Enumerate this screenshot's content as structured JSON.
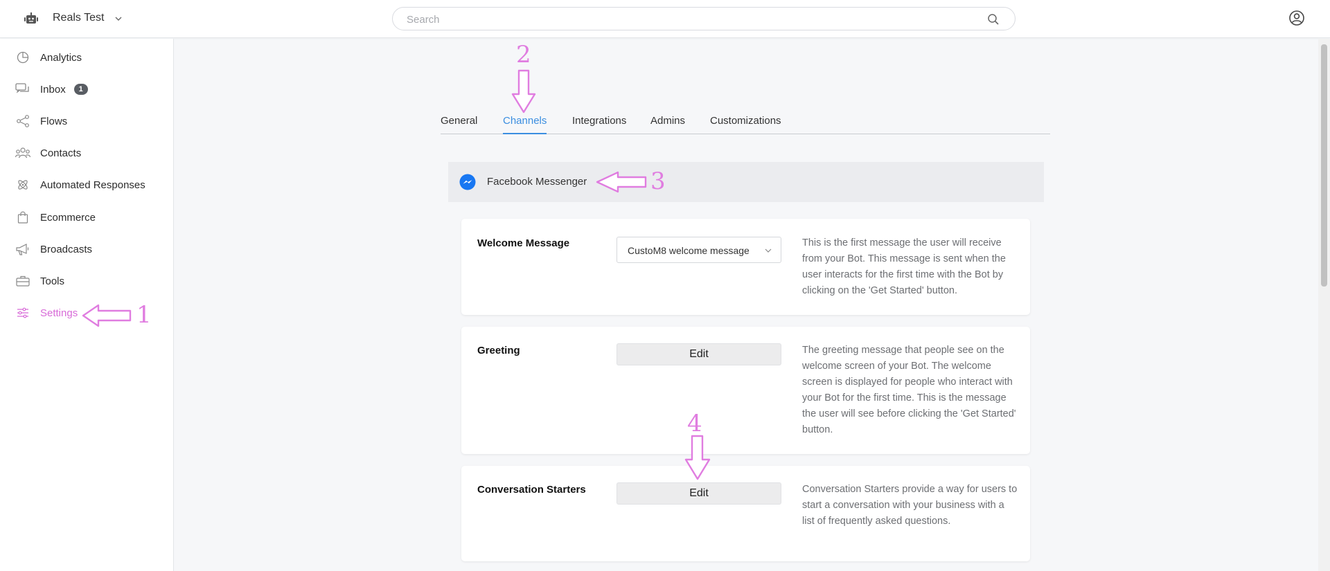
{
  "header": {
    "app_name": "Reals Test",
    "search_placeholder": "Search"
  },
  "sidebar": {
    "items": [
      {
        "label": "Analytics",
        "icon": "pie-chart-icon"
      },
      {
        "label": "Inbox",
        "icon": "chat-bubbles-icon",
        "badge": "1"
      },
      {
        "label": "Flows",
        "icon": "flow-nodes-icon"
      },
      {
        "label": "Contacts",
        "icon": "people-icon"
      },
      {
        "label": "Automated Responses",
        "icon": "atom-icon"
      },
      {
        "label": "Ecommerce",
        "icon": "shopping-bag-icon"
      },
      {
        "label": "Broadcasts",
        "icon": "megaphone-icon"
      },
      {
        "label": "Tools",
        "icon": "toolbox-icon"
      },
      {
        "label": "Settings",
        "icon": "sliders-icon",
        "active": true
      }
    ]
  },
  "tabs": [
    {
      "label": "General"
    },
    {
      "label": "Channels",
      "active": true
    },
    {
      "label": "Integrations"
    },
    {
      "label": "Admins"
    },
    {
      "label": "Customizations"
    }
  ],
  "channel": {
    "title": "Facebook Messenger"
  },
  "settings": {
    "welcome": {
      "title": "Welcome Message",
      "selected": "CustoM8 welcome message",
      "description": "This is the first message the user will receive from your Bot. This message is sent when the user interacts for the first time with the Bot by clicking on the 'Get Started' button."
    },
    "greeting": {
      "title": "Greeting",
      "button": "Edit",
      "description": "The greeting message that people see on the welcome screen of your Bot. The welcome screen is displayed for people who interact with your Bot for the first time. This is the message the user will see before clicking the 'Get Started' button."
    },
    "starters": {
      "title": "Conversation Starters",
      "button": "Edit",
      "description": "Conversation Starters provide a way for users to start a conversation with your business with a list of frequently asked questions."
    }
  },
  "annotations": {
    "one": "1",
    "two": "2",
    "three": "3",
    "four": "4"
  },
  "colors": {
    "accent": "#3b8ee0",
    "active_nav": "#d86bd8",
    "annotation": "#e07de0",
    "messenger": "#1877f2"
  }
}
